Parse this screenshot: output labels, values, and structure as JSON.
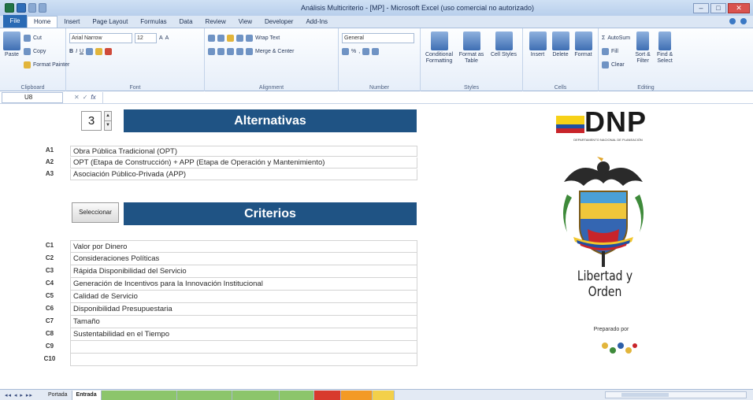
{
  "window": {
    "title": "Análisis Multicriterio - [MP] - Microsoft Excel (uso comercial no autorizado)"
  },
  "ribbon_tabs": [
    "Home",
    "Insert",
    "Page Layout",
    "Formulas",
    "Data",
    "Review",
    "View",
    "Developer",
    "Add-Ins"
  ],
  "file_tab": "File",
  "ribbon": {
    "clipboard": {
      "paste": "Paste",
      "cut": "Cut",
      "copy": "Copy",
      "format_painter": "Format Painter",
      "label": "Clipboard"
    },
    "font": {
      "name": "Arial Narrow",
      "size": "12",
      "label": "Font"
    },
    "alignment": {
      "wrap": "Wrap Text",
      "merge": "Merge & Center",
      "label": "Alignment"
    },
    "number": {
      "format": "General",
      "label": "Number"
    },
    "styles": {
      "conditional": "Conditional Formatting",
      "format_table": "Format as Table",
      "cell_styles": "Cell Styles",
      "label": "Styles"
    },
    "cells": {
      "insert": "Insert",
      "delete": "Delete",
      "format": "Format",
      "label": "Cells"
    },
    "editing": {
      "autosum": "AutoSum",
      "fill": "Fill",
      "clear": "Clear",
      "sort": "Sort & Filter",
      "find": "Find & Select",
      "label": "Editing"
    }
  },
  "formula_bar": {
    "name_box": "U8",
    "fx": "fx",
    "value": ""
  },
  "sheet": {
    "spinner_value": "3",
    "alternatives_header": "Alternativas",
    "criteria_header": "Criterios",
    "select_button": "Seleccionar",
    "alternatives": [
      {
        "code": "A1",
        "text": "Obra Pública Tradicional (OPT)"
      },
      {
        "code": "A2",
        "text": "OPT (Etapa de Construcción) + APP (Etapa de Operación y Mantenimiento)"
      },
      {
        "code": "A3",
        "text": "Asociación Público-Privada (APP)"
      }
    ],
    "criteria": [
      {
        "code": "C1",
        "text": "Valor por Dinero"
      },
      {
        "code": "C2",
        "text": "Consideraciones Políticas"
      },
      {
        "code": "C3",
        "text": "Rápida Disponibilidad del Servicio"
      },
      {
        "code": "C4",
        "text": "Generación de Incentivos para la Innovación Institucional"
      },
      {
        "code": "C5",
        "text": "Calidad de Servicio"
      },
      {
        "code": "C6",
        "text": "Disponibilidad Presupuestaria"
      },
      {
        "code": "C7",
        "text": "Tamaño"
      },
      {
        "code": "C8",
        "text": "Sustentabilidad en el Tiempo"
      },
      {
        "code": "C9",
        "text": ""
      },
      {
        "code": "C10",
        "text": ""
      }
    ],
    "logo_text": "DNP",
    "logo_subtitle": "DEPARTAMENTO NACIONAL DE PLANEACIÓN",
    "motto": "Libertad y Orden",
    "prepared_by": "Preparado por"
  },
  "sheet_tabs": {
    "nav": "◂◂ ◂ ▸ ▸▸",
    "tabs": [
      "Portada",
      "Entrada"
    ]
  },
  "colors": {
    "banner": "#1f5384",
    "excel_blue": "#2a6ab4"
  }
}
